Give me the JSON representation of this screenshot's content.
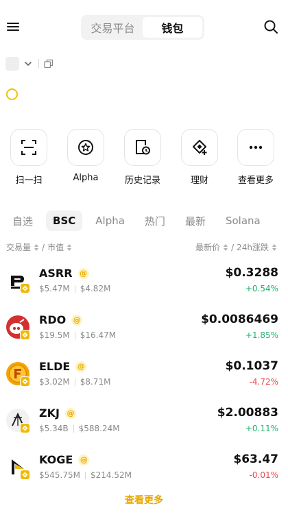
{
  "header": {
    "segments": [
      {
        "label": "交易平台",
        "active": false
      },
      {
        "label": "钱包",
        "active": true
      }
    ]
  },
  "quick_actions": [
    {
      "label": "扫一扫",
      "icon": "scan-icon"
    },
    {
      "label": "Alpha",
      "icon": "star-circle-icon"
    },
    {
      "label": "历史记录",
      "icon": "history-icon"
    },
    {
      "label": "理财",
      "icon": "earn-icon"
    },
    {
      "label": "查看更多",
      "icon": "more-icon"
    }
  ],
  "market_tabs": [
    {
      "label": "自选",
      "active": false
    },
    {
      "label": "BSC",
      "active": true
    },
    {
      "label": "Alpha",
      "active": false
    },
    {
      "label": "热门",
      "active": false
    },
    {
      "label": "最新",
      "active": false
    },
    {
      "label": "Solana",
      "active": false
    }
  ],
  "sort_header": {
    "volume": "交易量",
    "separator": "/",
    "market_cap": "市值",
    "latest_price": "最新价",
    "change_24h": "24h涨跌"
  },
  "tokens": [
    {
      "symbol": "ASRR",
      "volume": "$5.47M",
      "market_cap": "$4.82M",
      "price": "$0.3288",
      "change": "+0.54%",
      "direction": "up",
      "icon": "asrr-logo-icon"
    },
    {
      "symbol": "RDO",
      "volume": "$19.5M",
      "market_cap": "$16.47M",
      "price": "$0.0086469",
      "change": "+1.85%",
      "direction": "up",
      "icon": "rdo-logo-icon"
    },
    {
      "symbol": "ELDE",
      "volume": "$3.02M",
      "market_cap": "$8.71M",
      "price": "$0.1037",
      "change": "-4.72%",
      "direction": "down",
      "icon": "elde-logo-icon"
    },
    {
      "symbol": "ZKJ",
      "volume": "$5.34B",
      "market_cap": "$588.24M",
      "price": "$2.00883",
      "change": "+0.11%",
      "direction": "up",
      "icon": "zkj-logo-icon"
    },
    {
      "symbol": "KOGE",
      "volume": "$545.75M",
      "market_cap": "$214.52M",
      "price": "$63.47",
      "change": "-0.01%",
      "direction": "down",
      "icon": "koge-logo-icon"
    }
  ],
  "view_more": "查看更多",
  "colors": {
    "accent": "#F0B90B",
    "up": "#20B26C",
    "down": "#EF454A",
    "muted": "#8A8A8A"
  }
}
